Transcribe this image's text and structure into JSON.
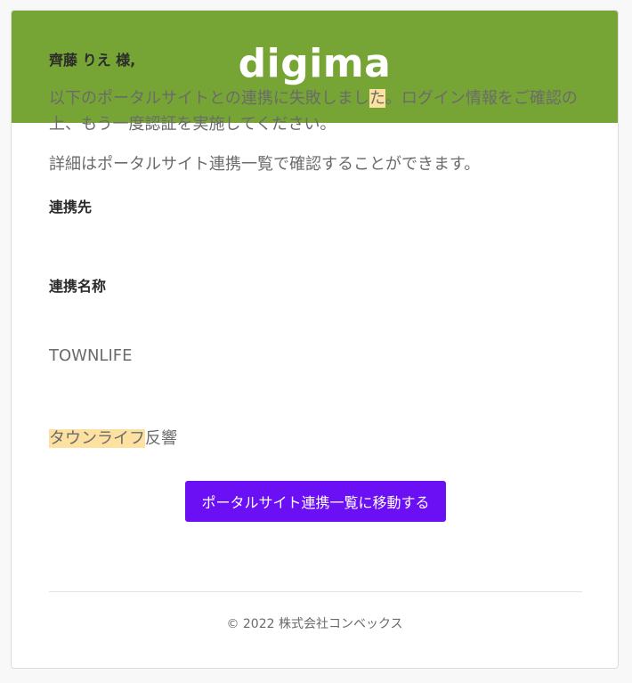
{
  "brand": {
    "logo_text": "digima",
    "header_color": "#76a535",
    "button_color": "#6b0ff5"
  },
  "email": {
    "greeting": "齊藤 りえ 様,",
    "message_part1": "以下のポータルサイトとの連携に失敗しまし",
    "message_highlight": "た",
    "message_part2": "。ログイン情報をご確認の上、もう一度認証を実施してください。",
    "detail_text": "詳細はポータルサイト連携一覧で確認することができます。",
    "destination_label": "連携先",
    "destination_value": "TOWNLIFE",
    "connection_name_label": "連携名称",
    "connection_name_highlight": "タウンライフ",
    "connection_name_rest": "反響",
    "button_label": "ポータルサイト連携一覧に移動する",
    "footer_text": "© 2022 株式会社コンベックス"
  }
}
